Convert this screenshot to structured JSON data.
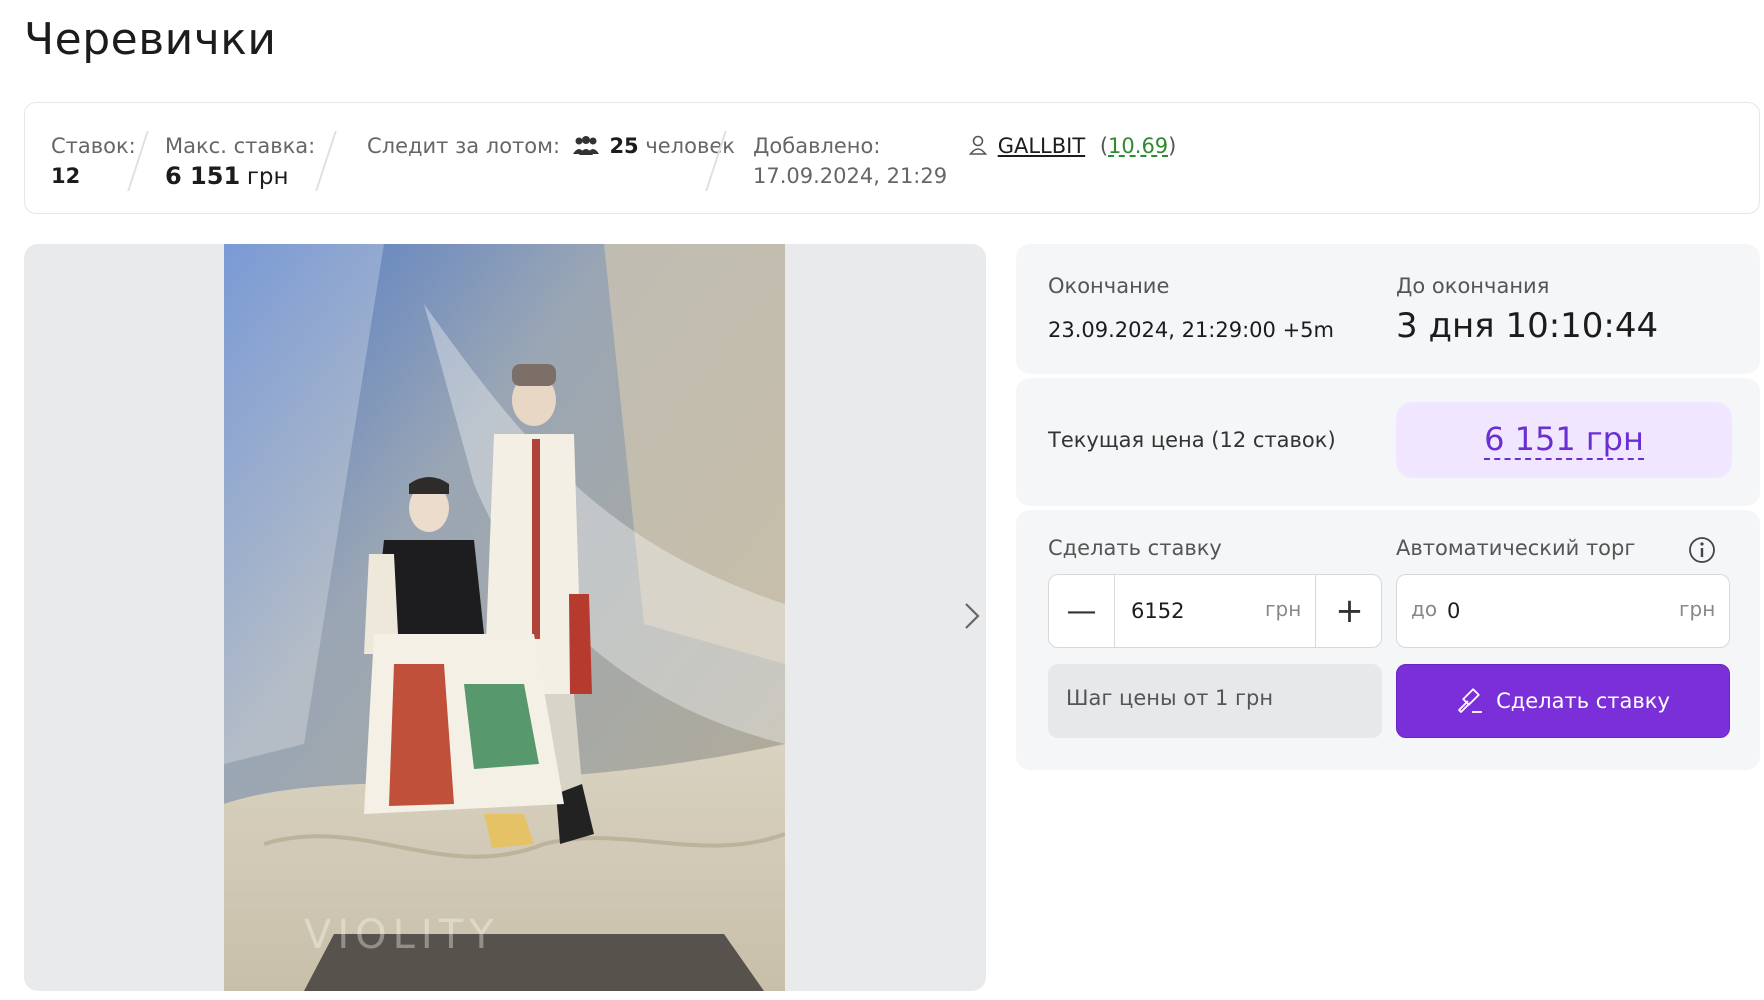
{
  "title": "Черевички",
  "stats": {
    "bids_label": "Ставок:",
    "bids_value": "12",
    "max_bid_label": "Макс. ставка:",
    "max_bid_value": "6 151",
    "max_bid_unit": "грн",
    "watchers_label": "Следит за лотом:",
    "watchers_count": "25",
    "watchers_unit": "человек",
    "added_label": "Добавлено:",
    "added_value": "17.09.2024, 21:29"
  },
  "seller": {
    "name": "GALLBIT",
    "rating": "10.69",
    "icon": "user-icon"
  },
  "gallery": {
    "watermark": "VIOLITY",
    "next_icon": "chevron-right-icon"
  },
  "ending": {
    "end_label": "Окончание",
    "end_value": "23.09.2024, 21:29:00 +5m",
    "remaining_label": "До окончания",
    "remaining_value": "3 дня 10:10:44"
  },
  "price": {
    "label": "Текущая цена (12 ставок)",
    "value": "6 151 грн"
  },
  "bid": {
    "label": "Сделать ставку",
    "value": "6152",
    "unit": "грн",
    "minus": "—",
    "plus": "+",
    "auto_label": "Автоматический торг",
    "auto_prefix": "до",
    "auto_value": "0",
    "auto_unit": "грн",
    "step_text": "Шаг цены от 1 грн",
    "submit_label": "Сделать ставку"
  },
  "colors": {
    "accent": "#7b2fd3",
    "price_bg": "#f1e6ff",
    "rating": "#2f8a2f"
  }
}
